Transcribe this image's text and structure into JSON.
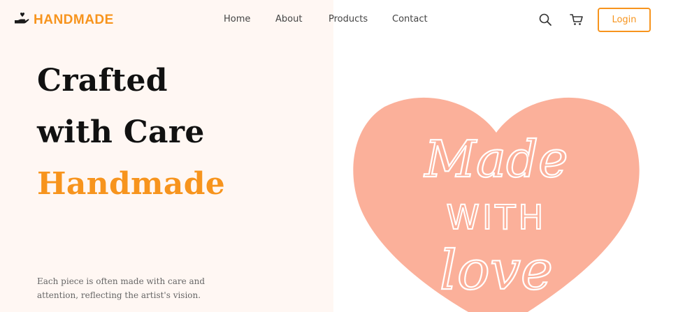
{
  "brand": {
    "name": "HANDMADE",
    "logo_icon": "hand-heart-icon",
    "color": "#f7941d"
  },
  "nav": {
    "items": [
      "Home",
      "About",
      "Products",
      "Contact"
    ]
  },
  "header": {
    "search_icon": "search-icon",
    "cart_icon": "cart-icon",
    "login_label": "Login"
  },
  "hero": {
    "line1": "Crafted",
    "line2": "with Care",
    "line3": "Handmade",
    "description": "Each piece is often made with care and attention, reflecting the artist's vision."
  },
  "illustration": {
    "lettering": [
      "Made",
      "WITH",
      "love"
    ],
    "heart_color": "#fbb09a"
  }
}
